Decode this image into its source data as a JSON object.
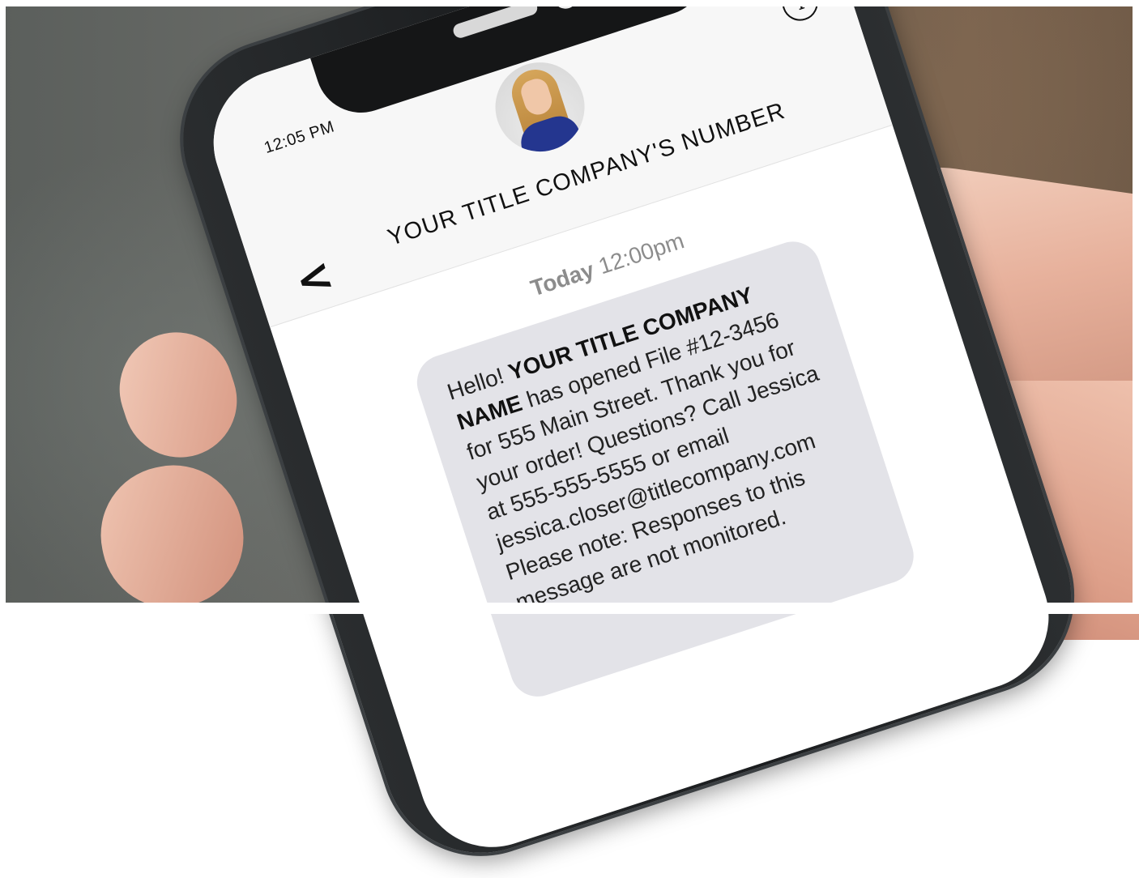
{
  "status_bar": {
    "time": "12:05 PM",
    "icons": [
      "wifi-icon",
      "battery-icon"
    ]
  },
  "header": {
    "contact_name": "YOUR TITLE COMPANY'S NUMBER",
    "avatar": "contact-avatar-photo",
    "info_icon": "i",
    "back_icon": "<"
  },
  "conversation": {
    "timestamp_day": "Today",
    "timestamp_time": "12:00pm",
    "message": {
      "greeting": "Hello!",
      "company": "YOUR TITLE COMPANY NAME",
      "body": "has opened File #12-3456 for 555 Main Street. Thank you for your order! Questions? Call Jessica at 555-555-5555 or email jessica.closer@titlecompany.com Please note: Responses to this message are not monitored."
    }
  },
  "colors": {
    "bubble": "#e3e3e8",
    "header_band": "#f7f7f7",
    "phone_body": "#1b1d1f"
  }
}
